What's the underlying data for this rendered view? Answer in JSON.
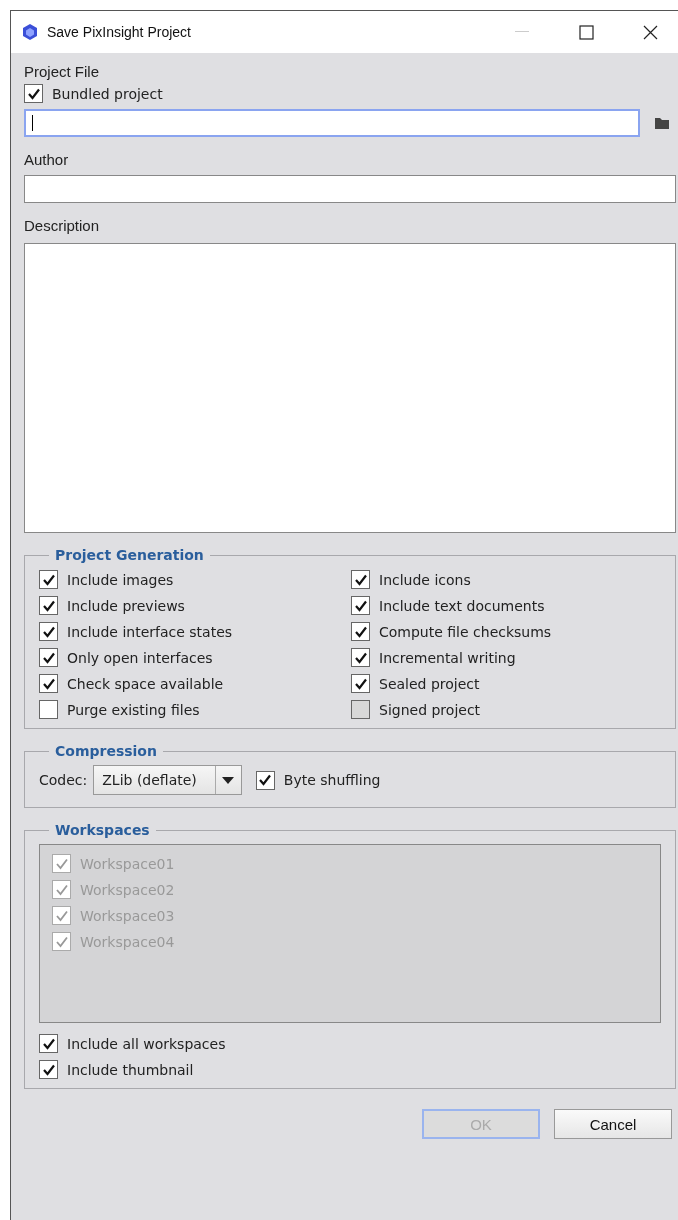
{
  "window": {
    "title": "Save PixInsight Project"
  },
  "project_file": {
    "label": "Project File",
    "bundled": {
      "label": "Bundled project",
      "checked": true
    },
    "path_field": {
      "focused": true
    }
  },
  "author": {
    "label": "Author"
  },
  "description": {
    "label": "Description"
  },
  "project_generation": {
    "title": "Project Generation",
    "options": [
      {
        "label": "Include images",
        "checked": true,
        "disabled": false
      },
      {
        "label": "Include icons",
        "checked": true,
        "disabled": false
      },
      {
        "label": "Include previews",
        "checked": true,
        "disabled": false
      },
      {
        "label": "Include text documents",
        "checked": true,
        "disabled": false
      },
      {
        "label": "Include interface states",
        "checked": true,
        "disabled": false
      },
      {
        "label": "Compute file checksums",
        "checked": true,
        "disabled": false
      },
      {
        "label": "Only open interfaces",
        "checked": true,
        "disabled": false
      },
      {
        "label": "Incremental writing",
        "checked": true,
        "disabled": false
      },
      {
        "label": "Check space available",
        "checked": true,
        "disabled": false
      },
      {
        "label": "Sealed project",
        "checked": true,
        "disabled": false
      },
      {
        "label": "Purge existing files",
        "checked": false,
        "disabled": false
      },
      {
        "label": "Signed project",
        "checked": false,
        "disabled": true
      }
    ]
  },
  "compression": {
    "title": "Compression",
    "codec_label": "Codec:",
    "codec_value": "ZLib (deflate)",
    "byte_shuffling": {
      "label": "Byte shuffling",
      "checked": true
    }
  },
  "workspaces": {
    "title": "Workspaces",
    "disabled": true,
    "items": [
      {
        "label": "Workspace01",
        "checked": true
      },
      {
        "label": "Workspace02",
        "checked": true
      },
      {
        "label": "Workspace03",
        "checked": true
      },
      {
        "label": "Workspace04",
        "checked": true
      }
    ],
    "options": [
      {
        "label": "Include all workspaces",
        "checked": true
      },
      {
        "label": "Include thumbnail",
        "checked": true
      }
    ]
  },
  "buttons": [
    {
      "label": "OK",
      "disabled": true,
      "focused": true
    },
    {
      "label": "Cancel",
      "disabled": false,
      "focused": false
    }
  ]
}
